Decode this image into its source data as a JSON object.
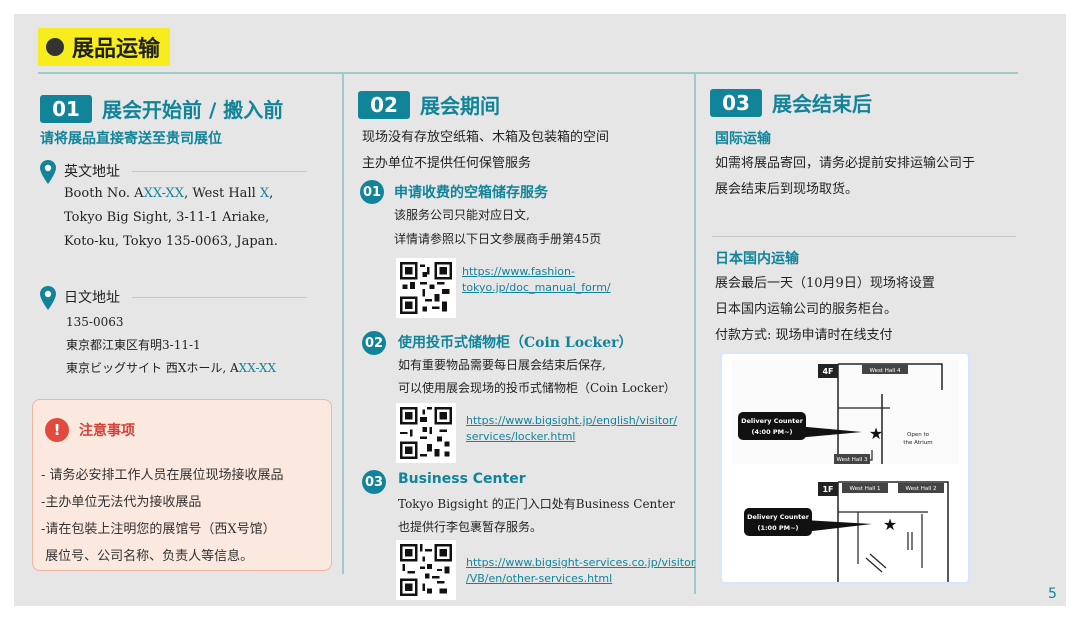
{
  "title": "展品运输",
  "page_number": "5",
  "colors": {
    "accent": "#12849a",
    "highlight": "#f6ec1e",
    "notice_bg": "#fbe8de",
    "notice_red": "#e24a3f"
  },
  "sec1": {
    "num": "01",
    "title": "展会开始前 / 搬入前",
    "subtitle": "请将展品直接寄送至贵司展位",
    "en_label": "英文地址",
    "en_line1_a": "Booth No. A",
    "en_line1_b": "XX-XX",
    "en_line1_c": ", West Hall ",
    "en_line1_d": "X",
    "en_line1_e": ",",
    "en_line2": "Tokyo Big Sight, 3-11-1 Ariake,",
    "en_line3": "Koto-ku, Tokyo 135-0063, Japan.",
    "jp_label": "日文地址",
    "jp_line1": "135-0063",
    "jp_line2": "東京都江東区有明3-11-1",
    "jp_line3_a": "東京ビッグサイト 西Xホール, A",
    "jp_line3_b": "XX-XX",
    "notice_icon": "!",
    "notice_title": "注意事项",
    "notice_lines": [
      "- 请务必安排工作人员在展位现场接收展品",
      "-主办单位无法代为接收展品",
      "-请在包裝上注明您的展馆号（西X号馆）",
      " 展位号、公司名称、负责人等信息。"
    ]
  },
  "sec2": {
    "num": "02",
    "title": "展会期间",
    "line1": "现场没有存放空纸箱、木箱及包装箱的空间",
    "line2": "主办单位不提供任何保管服务",
    "items": [
      {
        "num": "01",
        "title": "申请收费的空箱储存服务",
        "desc1": "该服务公司只能对应日文,",
        "desc2": "详情请参照以下日文参展商手册第45页",
        "link1": "https://www.fashion-",
        "link2": "tokyo.jp/doc_manual_form/"
      },
      {
        "num": "02",
        "title": "使用投币式储物柜（Coin Locker）",
        "desc1": "如有重要物品需要每日展会结束后保存,",
        "desc2": "可以使用展会现场的投币式储物柜（Coin Locker）",
        "link1": "https://www.bigsight.jp/english/visitor/",
        "link2": "services/locker.html"
      },
      {
        "num": "03",
        "title": "Business Center",
        "desc1": "Tokyo Bigsight 的正门入口处有Business Center",
        "desc2": "也提供行李包裹暂存服务。",
        "link1": "https://www.bigsight-services.co.jp/visitor",
        "link2": "/VB/en/other-services.html"
      }
    ]
  },
  "sec3": {
    "num": "03",
    "title": "展会结束后",
    "intl_title": "国际运输",
    "intl_line1": "如需将展品寄回，请务必提前安排运输公司于",
    "intl_line2": "展会结束后到现场取货。",
    "dom_title": "日本国内运输",
    "dom_line1": "展会最后一天（10月9日）现场将设置",
    "dom_line2": "日本国内运输公司的服务柜台。",
    "dom_line3": "付款方式: 现场申请时在线支付",
    "map": {
      "floor_top": "4F",
      "floor_bottom": "1F",
      "hall_4": "West Hall 4",
      "hall_3": "West Hall 3",
      "hall_1": "West Hall 1",
      "hall_2": "West Hall 2",
      "atrium_1": "Open to",
      "atrium_2": "the Atrium",
      "counter_top_1": "Delivery Counter",
      "counter_top_2": "(4:00 PM~)",
      "counter_bottom_1": "Delivery Counter",
      "counter_bottom_2": "(1:00 PM~)"
    }
  }
}
